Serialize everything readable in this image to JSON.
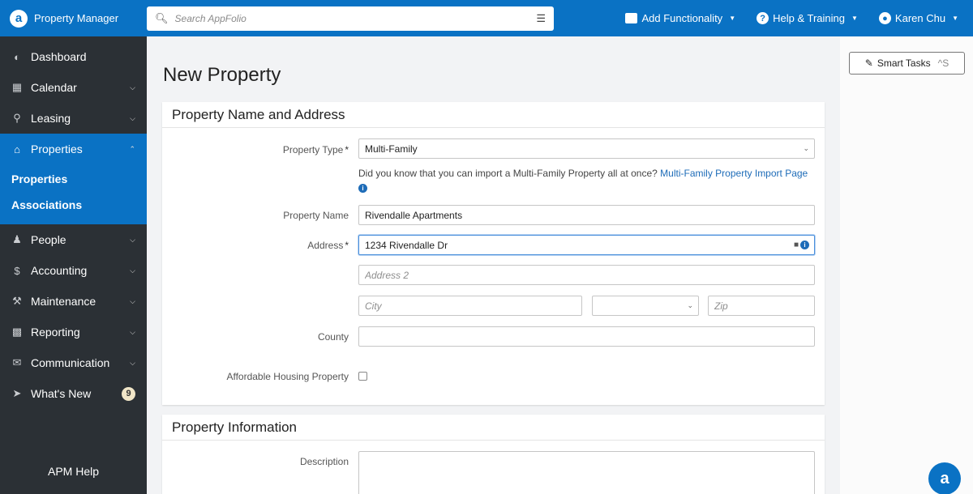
{
  "brand": {
    "name": "Property Manager",
    "logo_letter": "a"
  },
  "search": {
    "placeholder": "Search AppFolio"
  },
  "top_actions": {
    "add_functionality": "Add Functionality",
    "help_training": "Help & Training",
    "user_name": "Karen Chu"
  },
  "sidebar": {
    "items": [
      {
        "label": "Dashboard"
      },
      {
        "label": "Calendar"
      },
      {
        "label": "Leasing"
      },
      {
        "label": "Properties"
      },
      {
        "label": "People"
      },
      {
        "label": "Accounting"
      },
      {
        "label": "Maintenance"
      },
      {
        "label": "Reporting"
      },
      {
        "label": "Communication"
      },
      {
        "label": "What's New",
        "badge": "9"
      }
    ],
    "sub_items": [
      {
        "label": "Properties"
      },
      {
        "label": "Associations"
      }
    ],
    "footer": "APM Help"
  },
  "page": {
    "title": "New Property",
    "section1": {
      "title": "Property Name and Address",
      "property_type_label": "Property Type",
      "property_type_value": "Multi-Family",
      "required_mark": "*",
      "hint_text": "Did you know that you can import a Multi-Family Property all at once?",
      "hint_link": "Multi-Family Property Import Page",
      "property_name_label": "Property Name",
      "property_name_value": "Rivendalle Apartments",
      "address_label": "Address",
      "address_value": "1234 Rivendalle Dr",
      "address2_placeholder": "Address 2",
      "city_placeholder": "City",
      "zip_placeholder": "Zip",
      "county_label": "County",
      "affordable_label": "Affordable Housing Property"
    },
    "section2": {
      "title": "Property Information",
      "description_label": "Description"
    }
  },
  "right_panel": {
    "smart_tasks_label": "Smart Tasks",
    "smart_tasks_shortcut": "^S"
  },
  "fab": {
    "letter": "a"
  },
  "colors": {
    "brand_blue": "#0a72c4",
    "sidebar_dark": "#2b3035",
    "link_blue": "#1e6cb8"
  }
}
